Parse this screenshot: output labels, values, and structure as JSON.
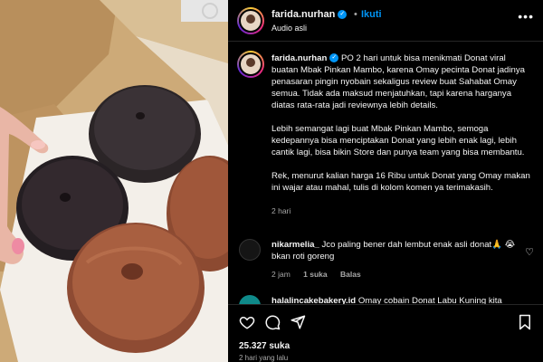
{
  "post": {
    "username": "farida.nurhan",
    "verified_mark": "✓",
    "separator": "•",
    "follow_label": "Ikuti",
    "audio_label": "Audio asli",
    "more_icon": "more-horizontal-icon",
    "caption_paragraphs": [
      "PO 2 hari untuk bisa menikmati Donat viral buatan Mbak Pinkan Mambo, karena Omay pecinta Donat jadinya penasaran pingin nyobain sekaligus review buat Sahabat Omay semua. Tidak ada maksud menjatuhkan, tapi karena harganya diatas rata-rata jadi reviewnya lebih details.",
      "Lebih semangat lagi buat Mbak Pinkan Mambo, semoga kedepannya bisa menciptakan Donat yang lebih enak lagi, lebih cantik lagi, bisa bikin Store dan punya team yang bisa membantu.",
      "Rek, menurut kalian harga 16 Ribu untuk Donat yang Omay makan ini wajar atau mahal, tulis di kolom komen ya terimakasih."
    ],
    "caption_time": "2 hari",
    "likes": "25.327 suka",
    "posted_ago": "2 hari yang lalu"
  },
  "comments": [
    {
      "username": "nikarmelia_",
      "text": "Jco paling bener dah lembut enak asli donat🙏 😭bkan roti goreng",
      "time": "2 jam",
      "likes": "1 suka",
      "reply_label": "Balas"
    },
    {
      "username": "halalincakebakery.id",
      "text": "Omay cobain Donat Labu Kuning kita"
    }
  ],
  "icons": {
    "like": "heart-icon",
    "comment": "comment-icon",
    "share": "send-icon",
    "save": "bookmark-icon"
  },
  "colors": {
    "accent": "#0095f6",
    "background": "#000000",
    "text": "#f5f5f5",
    "muted": "#a8a8a8"
  }
}
